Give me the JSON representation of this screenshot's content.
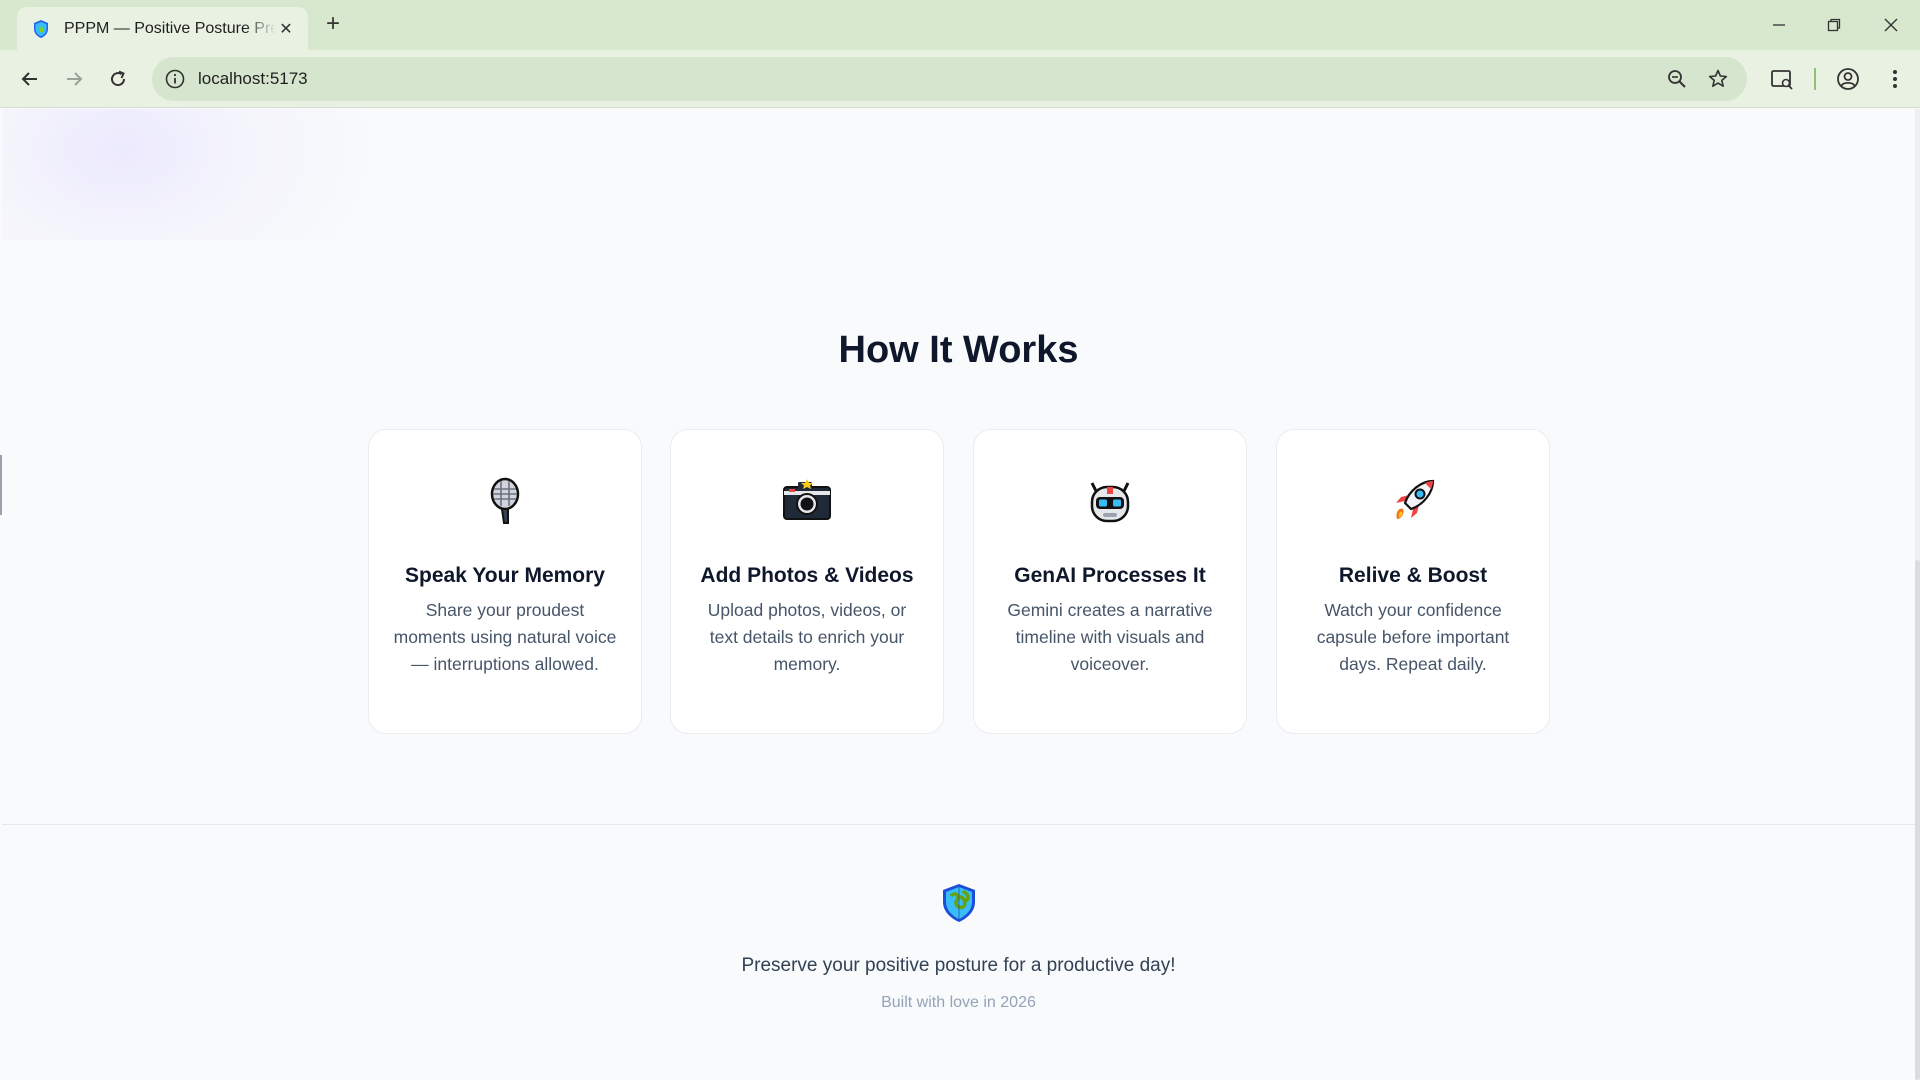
{
  "browser": {
    "tab_title": "PPPM — Positive Posture Preserver",
    "url": "localhost:5173"
  },
  "how_it_works": {
    "title": "How It Works",
    "steps": [
      {
        "icon": "microphone-icon",
        "title": "Speak Your Memory",
        "description": "Share your proudest moments using natural voice — interruptions allowed."
      },
      {
        "icon": "camera-icon",
        "title": "Add Photos & Videos",
        "description": "Upload photos, videos, or text details to enrich your memory."
      },
      {
        "icon": "robot-icon",
        "title": "GenAI Processes It",
        "description": "Gemini creates a narrative timeline with visuals and voiceover."
      },
      {
        "icon": "rocket-icon",
        "title": "Relive & Boost",
        "description": "Watch your confidence capsule before important days. Repeat daily."
      }
    ]
  },
  "footer": {
    "tagline": "Preserve your positive posture for a productive day!",
    "built_with": "Built with love in 2026"
  },
  "colors": {
    "chrome_tabbar": "#d7e8cf",
    "chrome_toolbar": "#e8f1e2",
    "page_background": "#f8fafc",
    "heading": "#0f172a",
    "body_text": "#475569"
  }
}
